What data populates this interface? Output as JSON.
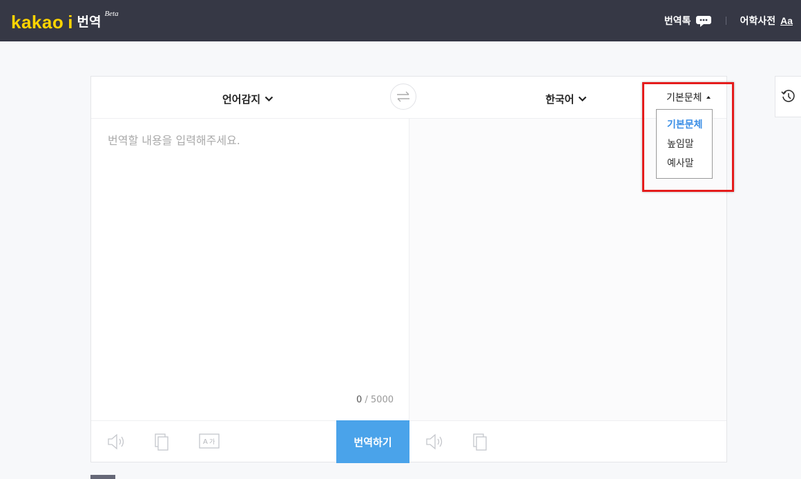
{
  "header": {
    "logo_kakao": "kakao",
    "logo_i": "i",
    "logo_title": "번역",
    "logo_beta": "Beta",
    "nav": {
      "talk_label": "번역톡",
      "dictionary_label": "어학사전",
      "dictionary_icon_text": "Aa"
    }
  },
  "translator": {
    "source_language": "언어감지",
    "target_language": "한국어",
    "style": {
      "current": "기본문체",
      "options": [
        "기본문체",
        "높임말",
        "예사말"
      ]
    },
    "input": {
      "placeholder": "번역할 내용을 입력해주세요.",
      "value": ""
    },
    "char_count": {
      "current": "0",
      "separator_max": " / 5000"
    },
    "translate_button": "번역하기",
    "tool_icons": [
      "speaker-icon",
      "copy-icon",
      "handwriting-icon"
    ]
  },
  "colors": {
    "topbar": "#363845",
    "logo_yellow": "#ffd400",
    "accent_blue": "#4aa3ea",
    "selected_option": "#3a8ee6",
    "highlight_red": "#e51c1c"
  }
}
